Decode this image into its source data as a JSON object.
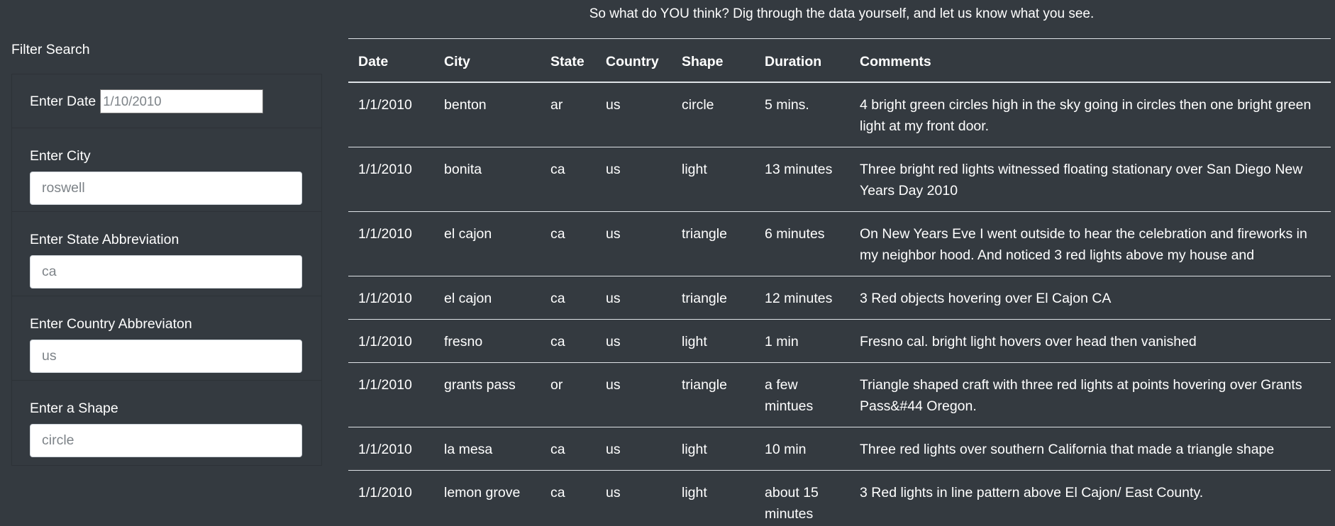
{
  "intro": "So what do YOU think? Dig through the data yourself, and let us know what you see.",
  "filters": {
    "heading": "Filter Search",
    "date": {
      "label": "Enter Date",
      "placeholder": "1/10/2010"
    },
    "city": {
      "label": "Enter City",
      "placeholder": "roswell"
    },
    "state": {
      "label": "Enter State Abbreviation",
      "placeholder": "ca"
    },
    "country": {
      "label": "Enter Country Abbreviaton",
      "placeholder": "us"
    },
    "shape": {
      "label": "Enter a Shape",
      "placeholder": "circle"
    }
  },
  "table": {
    "columns": [
      "Date",
      "City",
      "State",
      "Country",
      "Shape",
      "Duration",
      "Comments"
    ],
    "rows": [
      [
        "1/1/2010",
        "benton",
        "ar",
        "us",
        "circle",
        "5 mins.",
        "4 bright green circles high in the sky going in circles then one bright green light at my front door."
      ],
      [
        "1/1/2010",
        "bonita",
        "ca",
        "us",
        "light",
        "13 minutes",
        "Three bright red lights witnessed floating stationary over San Diego New Years Day 2010"
      ],
      [
        "1/1/2010",
        "el cajon",
        "ca",
        "us",
        "triangle",
        "6 minutes",
        "On New Years Eve I went outside to hear the celebration and fireworks in my neighbor hood. And noticed 3 red lights above my house and"
      ],
      [
        "1/1/2010",
        "el cajon",
        "ca",
        "us",
        "triangle",
        "12 minutes",
        "3 Red objects hovering over El Cajon CA"
      ],
      [
        "1/1/2010",
        "fresno",
        "ca",
        "us",
        "light",
        "1 min",
        "Fresno cal. bright light hovers over head then vanished"
      ],
      [
        "1/1/2010",
        "grants pass",
        "or",
        "us",
        "triangle",
        "a few mintues",
        "Triangle shaped craft with three red lights at points hovering over Grants Pass&#44 Oregon."
      ],
      [
        "1/1/2010",
        "la mesa",
        "ca",
        "us",
        "light",
        "10 min",
        "Three red lights over southern California that made a triangle shape"
      ],
      [
        "1/1/2010",
        "lemon grove",
        "ca",
        "us",
        "light",
        "about 15 minutes",
        "3 Red lights in line pattern above El Cajon/ East County."
      ]
    ]
  }
}
